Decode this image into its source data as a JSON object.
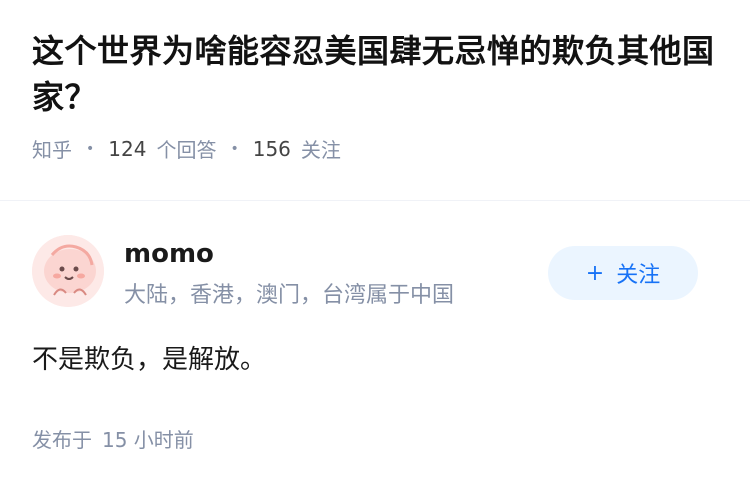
{
  "question": {
    "title": "这个世界为啥能容忍美国肆无忌惮的欺负其他国家？",
    "source": "知乎",
    "answer_count": "124",
    "answer_count_label": "个回答",
    "follower_count": "156",
    "follower_count_label": "关注"
  },
  "answer": {
    "author_name": "momo",
    "author_bio": "大陆，香港，澳门，台湾属于中国",
    "follow_button_icon": "+",
    "follow_button_label": "关注",
    "content": "不是欺负，是解放。",
    "published_label": "发布于",
    "published_time": "15 小时前"
  },
  "colors": {
    "meta_gray": "#8590a6",
    "accent_blue": "#1772f6",
    "follow_bg": "#ebf5ff",
    "avatar_bg": "#fde9e7"
  }
}
